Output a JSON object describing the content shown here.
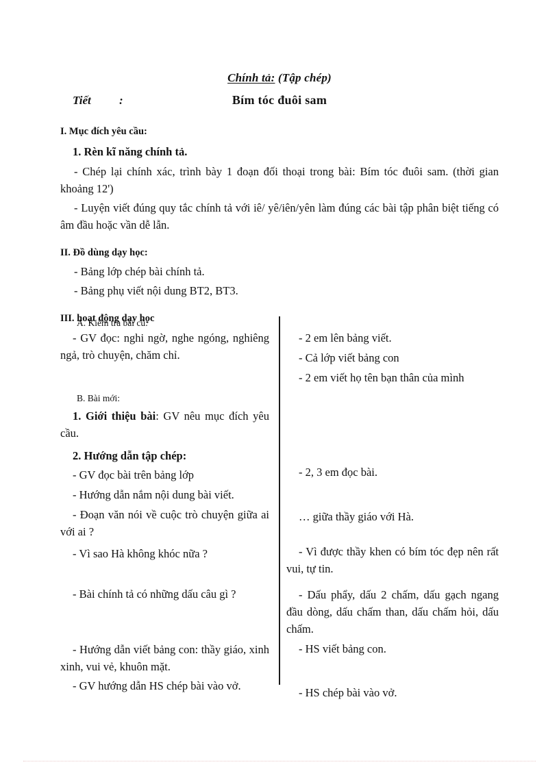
{
  "header": {
    "subject_underlined": "Chính tả:",
    "subject_rest": " (Tập chép)",
    "tiet_label": "Tiết",
    "tiet_colon": ":",
    "lesson_title": "Bím tóc đuôi sam"
  },
  "section_1": {
    "heading": "I. Mục đích yêu cầu:",
    "sub_heading": "1. Rèn kĩ năng chính tả.",
    "p1": "- Chép lại chính xác, trình bày 1 đoạn đối thoại trong bài: Bím tóc đuôi sam. (thời gian khoảng 12')",
    "p2": "- Luyện viết đúng quy tắc chính tả với iê/ yê/iên/yên làm đúng các bài tập phân biệt tiếng có âm đầu hoặc vần dễ lẫn."
  },
  "section_2": {
    "heading": "II. Đồ dùng dạy học:",
    "p1": "- Bảng lớp chép bài chính tả.",
    "p2": "- Bảng phụ viết nội dung BT2, BT3."
  },
  "section_3": {
    "heading": "III. hoạt động dạy học",
    "left": {
      "a_label": "A. Kiểm tra bài cũ:",
      "a_item": "- GV đọc: nghi ngờ, nghe ngóng, nghiêng ngả, trò chuyện, chăm chỉ.",
      "b_label": "B. Bài mới:",
      "b1_bold": "1. Giới thiệu bài",
      "b1_rest": ": GV nêu mục đích yêu cầu.",
      "b2_bold": "2. Hướng dẫn tập chép:",
      "item1": "- GV đọc bài trên bảng lớp",
      "item2": "- Hướng dẫn nắm nội dung bài viết.",
      "item3": "- Đoạn văn nói về cuộc trò chuyện giữa ai với ai ?",
      "item4": "- Vì sao Hà không khóc nữa ?",
      "item5": "- Bài chính tả có những dấu câu gì ?",
      "item6": "- Hướng dẫn viết bảng con: thầy giáo, xinh xinh, vui vẻ, khuôn mặt.",
      "item7": "- GV hướng dẫn HS chép bài vào vở."
    },
    "right": {
      "item1": "- 2 em lên bảng viết.",
      "item2": "- Cả lớp viết bảng con",
      "item3": "- 2 em viết họ tên bạn thân của mình",
      "item4": "- 2, 3 em đọc bài.",
      "item5": "… giữa thầy giáo với Hà.",
      "item6": "- Vì được thầy khen có bím tóc đẹp nên rất vui, tự tin.",
      "item7": "- Dấu phẩy, dấu 2 chấm, dấu gạch ngang đầu dòng, dấu chấm than, dấu chấm hỏi, dấu chấm.",
      "item8": "- HS viết bảng con.",
      "item9": "- HS chép bài vào vở."
    }
  }
}
